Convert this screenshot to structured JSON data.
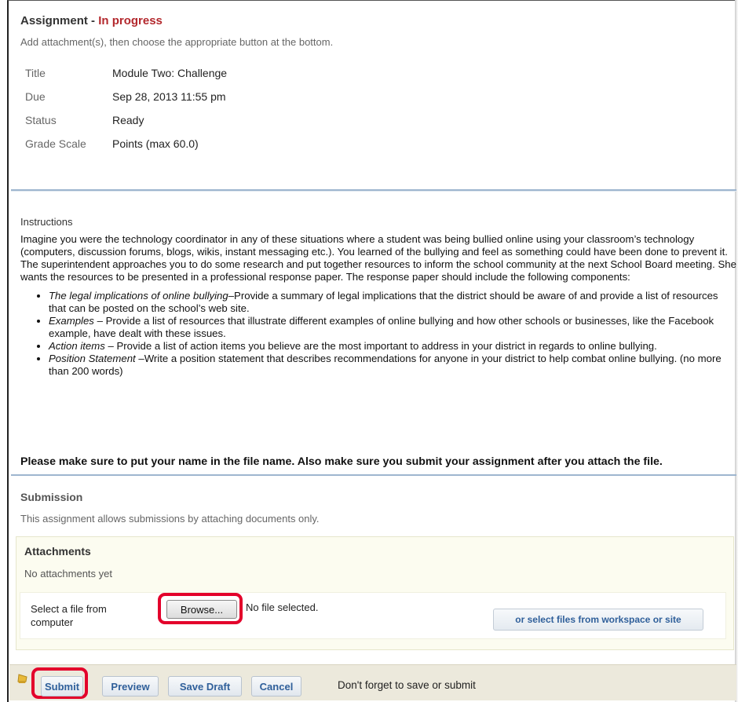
{
  "header": {
    "label": "Assignment",
    "separator": " - ",
    "status": "In progress",
    "note": "Add attachment(s), then choose the appropriate button at the bottom."
  },
  "properties": [
    {
      "key": "Title",
      "value": "Module Two: Challenge"
    },
    {
      "key": "Due",
      "value": "Sep 28, 2013 11:55 pm"
    },
    {
      "key": "Status",
      "value": "Ready"
    },
    {
      "key": "Grade Scale",
      "value": "Points (max 60.0)"
    }
  ],
  "instructions": {
    "label": "Instructions",
    "intro": " Imagine you were the technology coordinator in any of these situations where a student was being bullied online using your classroom’s technology (computers, discussion forums, blogs, wikis, instant messaging etc.). You learned of the bullying and feel as something could have been done to prevent it. The superintendent approaches you to do some research and put together resources to inform the school community at the next School Board meeting. She wants the resources to be presented in a professional response paper. The response paper should include the following components:",
    "items": [
      {
        "lead": "The legal implications of online bullying",
        "text": "–Provide a summary of legal implications that the district should be aware of and provide a list of resources that can be posted on the school’s web site."
      },
      {
        "lead": "Examples",
        "text": " – Provide a list of resources that illustrate different examples of online bullying and how other schools or businesses, like the Facebook example, have dealt with these issues."
      },
      {
        "lead": "Action items",
        "text": " – Provide a list of action items you believe are the most important to address in your district in regards to online bullying."
      },
      {
        "lead": "Position Statement",
        "text": " –Write a position statement that describes recommendations for anyone in your district to help combat online bullying. (no more than 200 words)"
      }
    ],
    "bold_note": "Please make sure to put your name in the file name.  Also make sure you submit your assignment after you attach the file."
  },
  "submission": {
    "title": "Submission",
    "note": "This assignment allows submissions by attaching documents only."
  },
  "attachments": {
    "title": "Attachments",
    "empty": "No attachments yet",
    "file_label": "Select a file from computer",
    "browse_label": "Browse...",
    "no_file": "No file selected.",
    "workspace_button": "or select files from workspace or site"
  },
  "actions": {
    "submit": "Submit",
    "preview": "Preview",
    "save_draft": "Save Draft",
    "cancel": "Cancel",
    "reminder": "Don't forget to save or submit"
  },
  "icons": {
    "action_bar": "bell-icon"
  },
  "colors": {
    "status": "#b3282d",
    "highlight": "#e3002b",
    "button_text": "#2f5f9a",
    "separator": "#9eb6cf"
  }
}
